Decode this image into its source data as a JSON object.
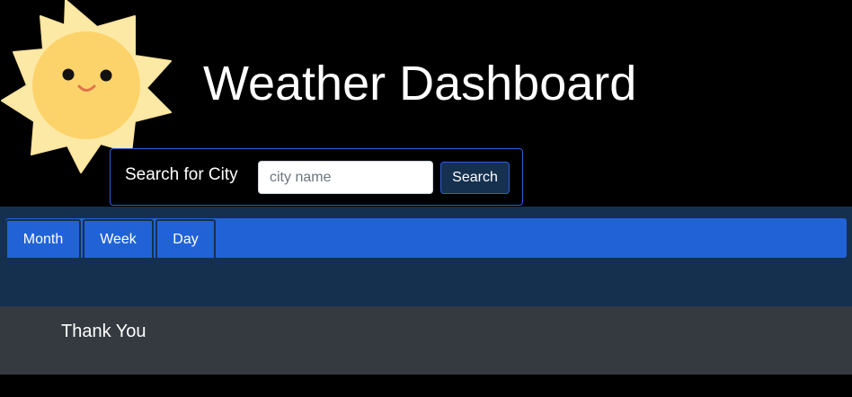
{
  "header": {
    "title": "Weather Dashboard",
    "logo_icon": "smiling-sun-icon"
  },
  "search": {
    "label": "Search for City",
    "placeholder": "city name",
    "value": "",
    "button_label": "Search"
  },
  "tabs": [
    {
      "label": "Month"
    },
    {
      "label": "Week"
    },
    {
      "label": "Day"
    }
  ],
  "footer": {
    "text": "Thank You"
  },
  "colors": {
    "background": "#000000",
    "nav_background": "#15304f",
    "tab_bar": "#2163d6",
    "footer_background": "#343a40",
    "accent_border": "#2b5fd9",
    "sun_face": "#fcd36b",
    "sun_rays": "#fde9a6"
  }
}
